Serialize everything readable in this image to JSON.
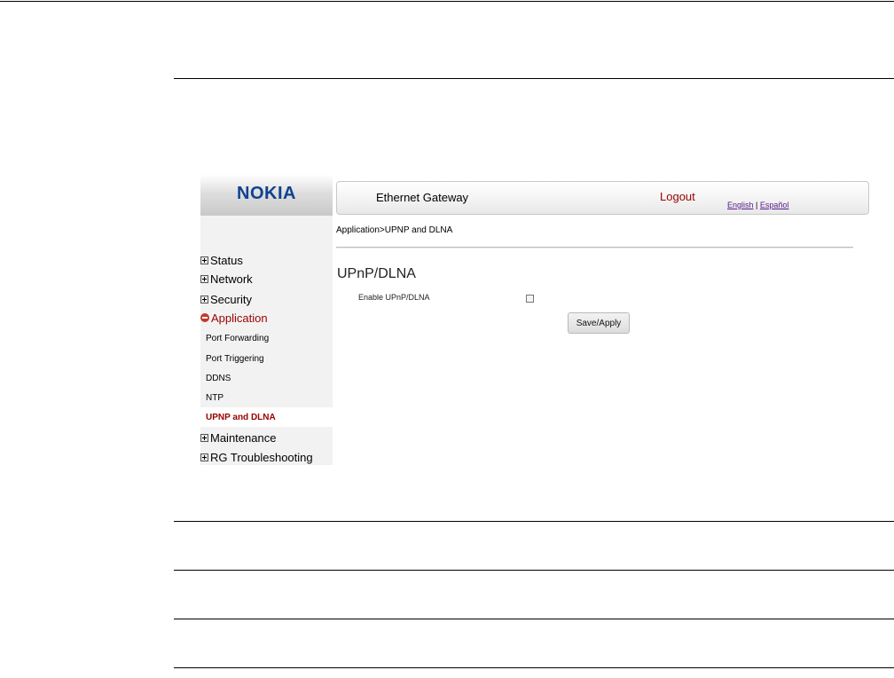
{
  "brand": {
    "logo_text": "NOKIA",
    "logo_color": "#124191"
  },
  "header": {
    "title": "Ethernet Gateway",
    "logout_label": "Logout",
    "languages": [
      "English",
      "Español"
    ],
    "language_separator": "|"
  },
  "breadcrumb": "Application>UPNP and DLNA",
  "sidebar": {
    "items": [
      {
        "label": "Status",
        "icon": "plus-icon",
        "expanded": false
      },
      {
        "label": "Network",
        "icon": "plus-icon",
        "expanded": false
      },
      {
        "label": "Security",
        "icon": "plus-icon",
        "expanded": false
      },
      {
        "label": "Application",
        "icon": "minus-icon",
        "expanded": true
      },
      {
        "label": "Maintenance",
        "icon": "plus-icon",
        "expanded": false
      },
      {
        "label": "RG Troubleshooting",
        "icon": "plus-icon",
        "expanded": false
      }
    ],
    "subitems": [
      "Port Forwarding",
      "Port Triggering",
      "DDNS",
      "NTP",
      "UPNP and DLNA"
    ],
    "current_subitem": "UPNP and DLNA"
  },
  "main": {
    "section_title": "UPnP/DLNA",
    "enable_label": "Enable UPnP/DLNA",
    "enable_checked": false,
    "save_label": "Save/Apply"
  },
  "colors": {
    "accent": "#990000",
    "sidebar_bg": "#f2f2f2"
  }
}
